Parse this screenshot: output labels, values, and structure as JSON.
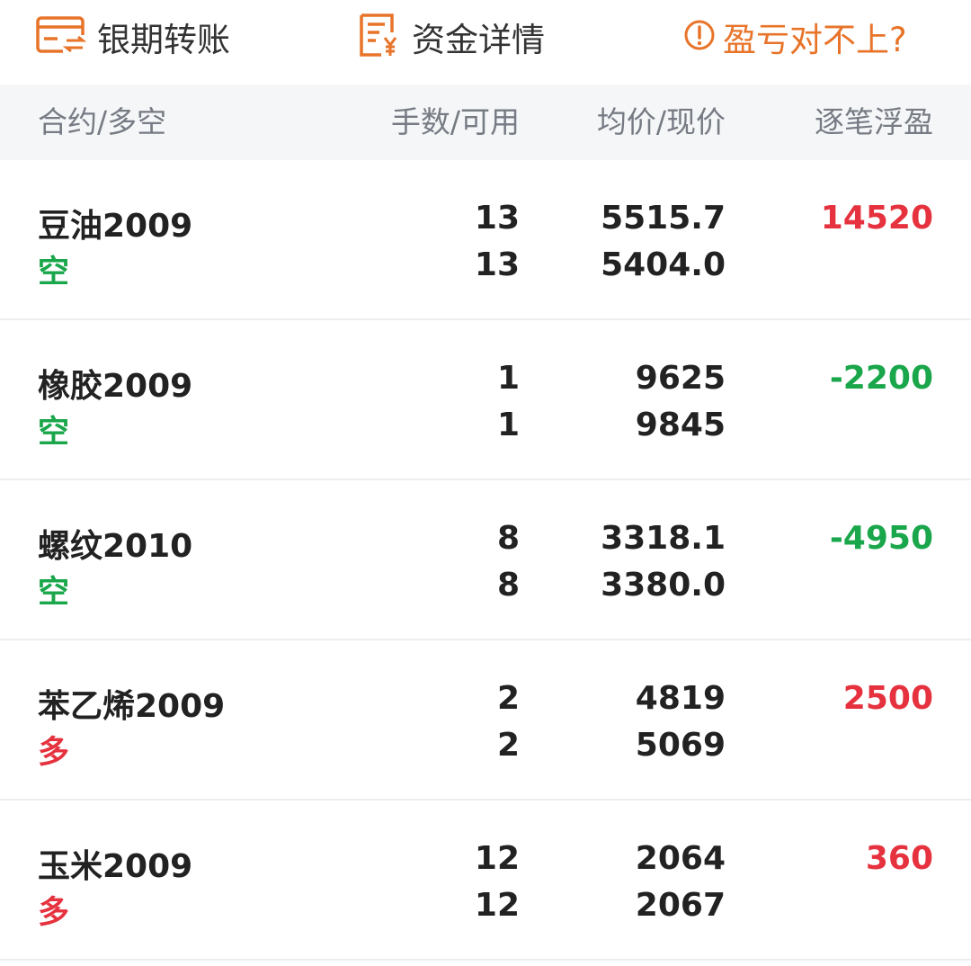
{
  "toolbar": {
    "transfer_label": "银期转账",
    "funds_label": "资金详情",
    "pnl_help_label": "盈亏对不上?",
    "transfer_icon": "card-transfer-icon",
    "funds_icon": "document-yen-icon",
    "pnl_help_icon": "exclamation-circle-icon",
    "accent_color": "#e8742a"
  },
  "table": {
    "headers": [
      "合约/多空",
      "手数/可用",
      "均价/现价",
      "逐笔浮盈"
    ],
    "rows": [
      {
        "contract": "豆油2009",
        "direction": "空",
        "direction_type": "short",
        "lots": "13",
        "available": "13",
        "avg_price": "5515.7",
        "last_price": "5404.0",
        "float_pnl": "14520",
        "pnl_sign": "up"
      },
      {
        "contract": "橡胶2009",
        "direction": "空",
        "direction_type": "short",
        "lots": "1",
        "available": "1",
        "avg_price": "9625",
        "last_price": "9845",
        "float_pnl": "-2200",
        "pnl_sign": "down"
      },
      {
        "contract": "螺纹2010",
        "direction": "空",
        "direction_type": "short",
        "lots": "8",
        "available": "8",
        "avg_price": "3318.1",
        "last_price": "3380.0",
        "float_pnl": "-4950",
        "pnl_sign": "down"
      },
      {
        "contract": "苯乙烯2009",
        "direction": "多",
        "direction_type": "long",
        "lots": "2",
        "available": "2",
        "avg_price": "4819",
        "last_price": "5069",
        "float_pnl": "2500",
        "pnl_sign": "up"
      },
      {
        "contract": "玉米2009",
        "direction": "多",
        "direction_type": "long",
        "lots": "12",
        "available": "12",
        "avg_price": "2064",
        "last_price": "2067",
        "float_pnl": "360",
        "pnl_sign": "up"
      }
    ]
  },
  "colors": {
    "profit": "#e5323e",
    "loss": "#1aa64a",
    "short": "#1aa64a",
    "long": "#e5323e",
    "header_bg": "#f5f6f8"
  }
}
